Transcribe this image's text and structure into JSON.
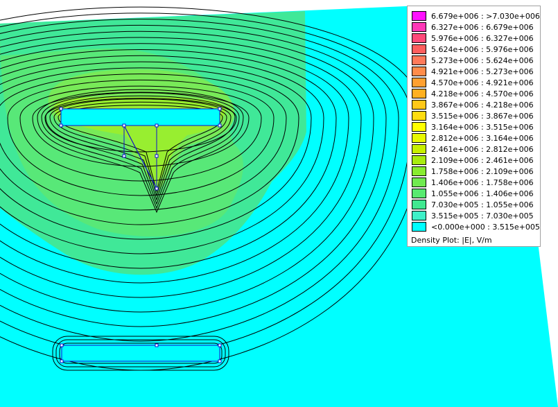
{
  "legend": {
    "entries": [
      {
        "label": "6.679e+006 : >7.030e+006",
        "color": "#ff10ff"
      },
      {
        "label": "6.327e+006 : 6.679e+006",
        "color": "#ff38b8"
      },
      {
        "label": "5.976e+006 : 6.327e+006",
        "color": "#ff4a7a"
      },
      {
        "label": "5.624e+006 : 5.976e+006",
        "color": "#fe5e5e"
      },
      {
        "label": "5.273e+006 : 5.624e+006",
        "color": "#ff7a5a"
      },
      {
        "label": "4.921e+006 : 5.273e+006",
        "color": "#ff8c4a"
      },
      {
        "label": "4.570e+006 : 4.921e+006",
        "color": "#ffa030"
      },
      {
        "label": "4.218e+006 : 4.570e+006",
        "color": "#ffb020"
      },
      {
        "label": "3.867e+006 : 4.218e+006",
        "color": "#ffc818"
      },
      {
        "label": "3.515e+006 : 3.867e+006",
        "color": "#ffdc10"
      },
      {
        "label": "3.164e+006 : 3.515e+006",
        "color": "#ffff00"
      },
      {
        "label": "2.812e+006 : 3.164e+006",
        "color": "#e8f800"
      },
      {
        "label": "2.461e+006 : 2.812e+006",
        "color": "#c8f000"
      },
      {
        "label": "2.109e+006 : 2.461e+006",
        "color": "#a8ec10"
      },
      {
        "label": "1.758e+006 : 2.109e+006",
        "color": "#88ec30"
      },
      {
        "label": "1.406e+006 : 1.758e+006",
        "color": "#70ea50"
      },
      {
        "label": "1.055e+006 : 1.406e+006",
        "color": "#58ea70"
      },
      {
        "label": "7.030e+005 : 1.055e+006",
        "color": "#40e890"
      },
      {
        "label": "3.515e+005 : 7.030e+005",
        "color": "#3ef0c8"
      },
      {
        "label": "<0.000e+000 : 3.515e+005",
        "color": "#00ffff"
      }
    ],
    "title": "Density Plot: |E|, V/m"
  },
  "colors": {
    "background": "#00ffff",
    "zone_outer": "#40e898",
    "zone_middle": "#58e878",
    "contour": "#000000",
    "geometry": "#1010d0"
  }
}
